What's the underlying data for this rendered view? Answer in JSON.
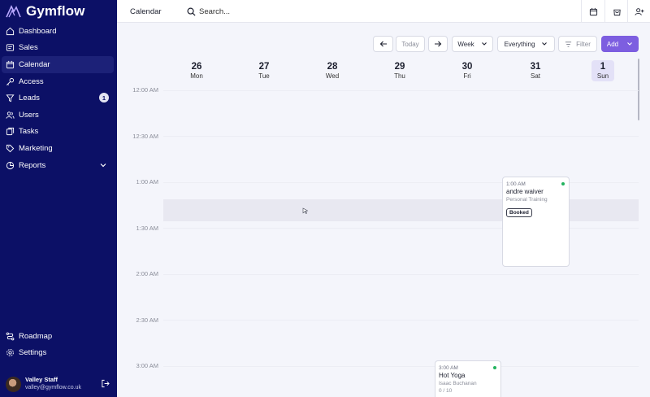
{
  "app": {
    "name": "Gymflow"
  },
  "sidebar": {
    "items": [
      {
        "label": "Dashboard",
        "icon": "home-icon"
      },
      {
        "label": "Sales",
        "icon": "sales-icon"
      },
      {
        "label": "Calendar",
        "icon": "calendar-icon",
        "active": true
      },
      {
        "label": "Access",
        "icon": "key-icon"
      },
      {
        "label": "Leads",
        "icon": "funnel-icon",
        "badge": "1"
      },
      {
        "label": "Users",
        "icon": "users-icon"
      },
      {
        "label": "Tasks",
        "icon": "tasks-icon"
      },
      {
        "label": "Marketing",
        "icon": "tag-icon"
      },
      {
        "label": "Reports",
        "icon": "reports-icon"
      }
    ],
    "bottom_items": [
      {
        "label": "Roadmap",
        "icon": "roadmap-icon"
      },
      {
        "label": "Settings",
        "icon": "gear-icon"
      }
    ],
    "user": {
      "name": "Valley Staff",
      "email": "valley@gymflow.co.uk"
    }
  },
  "header": {
    "title": "Calendar",
    "search_placeholder": "Search..."
  },
  "toolbar": {
    "today": "Today",
    "view": "Week",
    "filter_scope": "Everything",
    "filter": "Filter",
    "add": "Add"
  },
  "days": [
    {
      "num": "26",
      "weekday": "Mon"
    },
    {
      "num": "27",
      "weekday": "Tue"
    },
    {
      "num": "28",
      "weekday": "Wed"
    },
    {
      "num": "29",
      "weekday": "Thu"
    },
    {
      "num": "30",
      "weekday": "Fri"
    },
    {
      "num": "31",
      "weekday": "Sat"
    },
    {
      "num": "1",
      "weekday": "Sun",
      "today": true
    }
  ],
  "times": [
    "12:00 AM",
    "12:30 AM",
    "1:00 AM",
    "1:30 AM",
    "2:00 AM",
    "2:30 AM",
    "3:00 AM"
  ],
  "events": [
    {
      "time": "1:00 AM",
      "title": "andre waiver",
      "subtitle": "Personal Training",
      "status": "Booked",
      "day": "Sat"
    },
    {
      "time": "3:00 AM",
      "title": "Hot Yoga",
      "subtitle": "Isaac Buchanan",
      "capacity": "0 / 10",
      "day": "Fri"
    }
  ],
  "colors": {
    "sidebar": "#0c1066",
    "accent": "#7d5ee0",
    "status_dot": "#22b35e"
  }
}
